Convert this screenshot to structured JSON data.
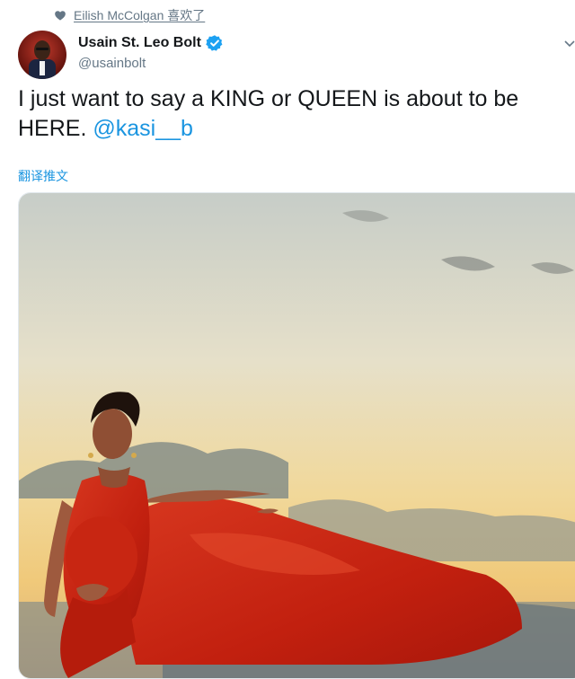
{
  "social_context": {
    "text": "Eilish McColgan 喜欢了",
    "icon": "heart-icon"
  },
  "author": {
    "name": "Usain St. Leo Bolt",
    "handle": "@usainbolt",
    "verified": true,
    "verified_color": "#1da1f2"
  },
  "tweet": {
    "text_before": "I just want to say a KING or QUEEN is about to be HERE. ",
    "mention": "@kasi__b",
    "mention_color": "#1b95e0"
  },
  "translate_label": "翻译推文",
  "media": {
    "alt": "photo"
  },
  "menu_caret_icon": "chevron-down-icon"
}
